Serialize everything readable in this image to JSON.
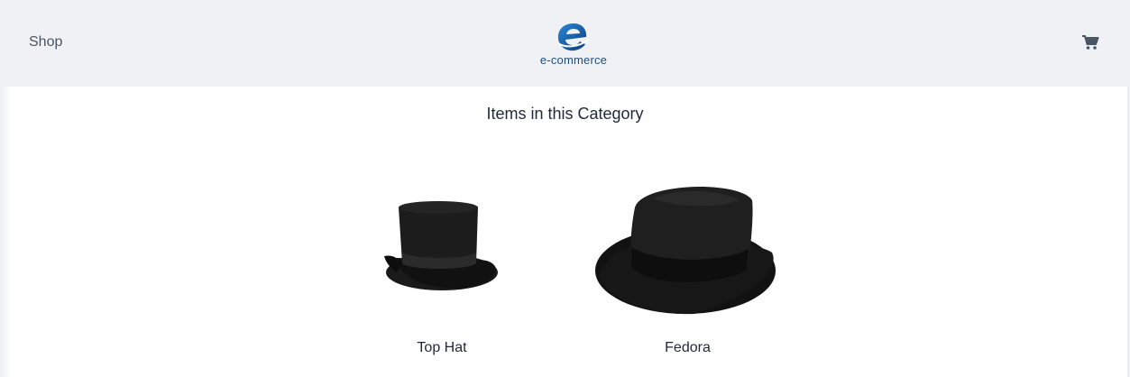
{
  "header": {
    "nav_label": "Shop",
    "logo_text": "e-commerce",
    "cart_icon": "cart-icon"
  },
  "main": {
    "title": "Items in this Category",
    "products": [
      {
        "name": "Top Hat",
        "image": "top-hat-image"
      },
      {
        "name": "Fedora",
        "image": "fedora-image"
      }
    ]
  },
  "colors": {
    "header_bg": "#f0f1f5",
    "brand_blue": "#1565c0",
    "text_dark": "#1f2937",
    "nav_text": "#4a5563"
  }
}
